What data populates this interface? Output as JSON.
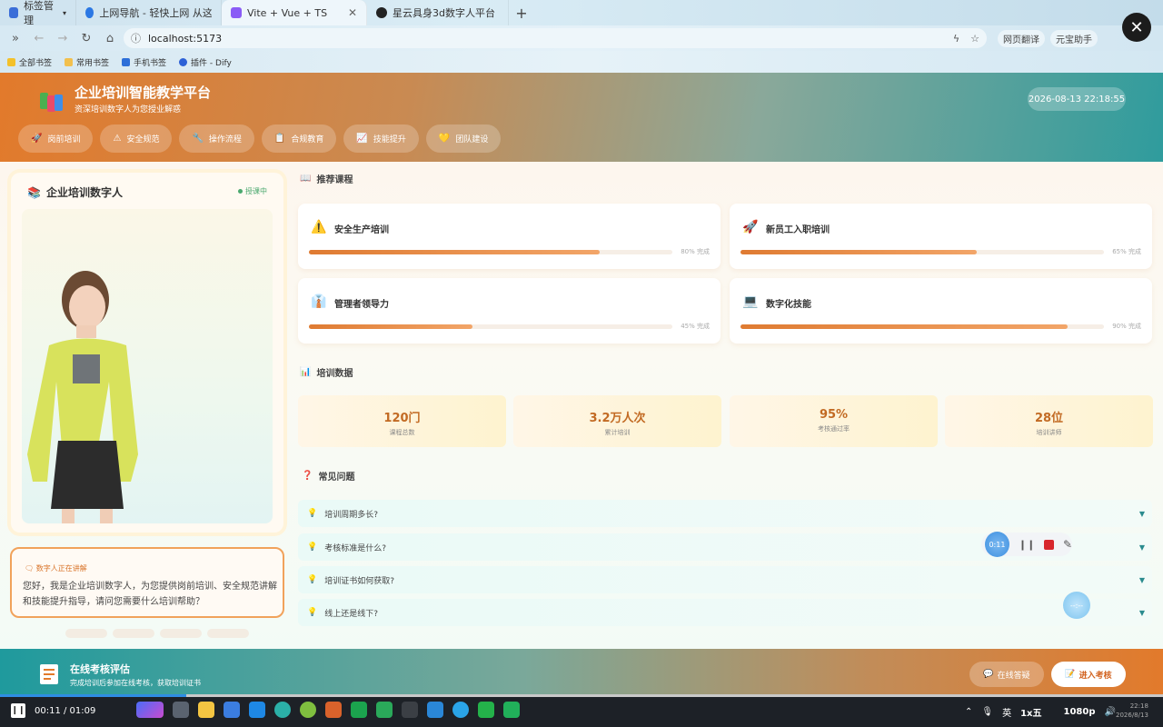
{
  "browser": {
    "tabs": [
      {
        "label": "标签管理",
        "color": "#3b6ed8"
      },
      {
        "label": "上网导航 - 轻快上网 从这里开始",
        "color": "#2b78e4"
      },
      {
        "label": "Vite + Vue + TS",
        "color": "#8a5cf6"
      },
      {
        "label": "星云具身3d数字人平台",
        "color": "#222222"
      }
    ],
    "url": "localhost:5173",
    "extensions": [
      "网页翻译",
      "元宝助手"
    ],
    "bookmarks": [
      "全部书签",
      "常用书签",
      "手机书签",
      "插件 - Dify"
    ]
  },
  "header": {
    "title": "企业培训智能教学平台",
    "subtitle": "资深培训数字人为您授业解惑",
    "datetime": "2026-08-13 22:18:55",
    "nav": [
      {
        "label": "岗前培训",
        "icon": "rocket-icon"
      },
      {
        "label": "安全规范",
        "icon": "warning-icon"
      },
      {
        "label": "操作流程",
        "icon": "wrench-icon"
      },
      {
        "label": "合规教育",
        "icon": "document-icon"
      },
      {
        "label": "技能提升",
        "icon": "chart-icon"
      },
      {
        "label": "团队建设",
        "icon": "heart-icon"
      }
    ]
  },
  "avatar": {
    "title": "企业培训数字人",
    "status": "授课中",
    "speaking_label": "数字人正在讲解",
    "speech": "您好，我是企业培训数字人，为您提供岗前培训、安全规范讲解和技能提升指导，请问您需要什么培训帮助？"
  },
  "courses": {
    "title": "推荐课程",
    "items": [
      {
        "name": "安全生产培训",
        "progress": 80,
        "pct_text": "80% 完成",
        "icon": "warning-icon"
      },
      {
        "name": "新员工入职培训",
        "progress": 65,
        "pct_text": "65% 完成",
        "icon": "rocket-icon"
      },
      {
        "name": "管理者领导力",
        "progress": 45,
        "pct_text": "45% 完成",
        "icon": "people-icon"
      },
      {
        "name": "数字化技能",
        "progress": 90,
        "pct_text": "90% 完成",
        "icon": "computer-icon"
      }
    ]
  },
  "stats": {
    "title": "培训数据",
    "items": [
      {
        "value": "120门",
        "label": "课程总数"
      },
      {
        "value": "3.2万人次",
        "label": "累计培训"
      },
      {
        "value": "95%",
        "label": "考核通过率"
      },
      {
        "value": "28位",
        "label": "培训讲师"
      }
    ]
  },
  "faq": {
    "title": "常见问题",
    "items": [
      "培训周期多长?",
      "考核标准是什么?",
      "培训证书如何获取?",
      "线上还是线下?"
    ]
  },
  "recorder": {
    "time": "0:11",
    "float_time": "--:--"
  },
  "footer": {
    "title": "在线考核评估",
    "subtitle": "完成培训后参加在线考核，获取培训证书",
    "btn_ask": "在线答疑",
    "btn_exam": "进入考核"
  },
  "player": {
    "time": "00:11 / 01:09",
    "progress": 0.16,
    "ime": "英",
    "input_mode": "1x五",
    "quality": "1080p",
    "clock_time": "22:18",
    "clock_date": "2026/8/13"
  }
}
